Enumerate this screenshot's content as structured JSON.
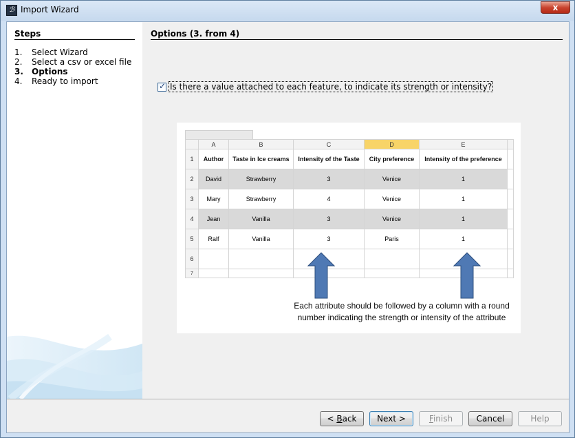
{
  "window": {
    "title": "Import Wizard",
    "close_glyph": "x",
    "app_icon_glyph": "ℬ"
  },
  "steps": {
    "title": "Steps",
    "items": [
      {
        "num": "1.",
        "label": "Select Wizard",
        "active": false
      },
      {
        "num": "2.",
        "label": "Select a csv or excel file",
        "active": false
      },
      {
        "num": "3.",
        "label": "Options",
        "active": true
      },
      {
        "num": "4.",
        "label": "Ready to import",
        "active": false
      }
    ]
  },
  "options": {
    "title": "Options (3. from 4)",
    "checkbox_label": "Is there a value attached to each feature, to indicate its strength or intensity?",
    "checkbox_checked": true
  },
  "spreadsheet": {
    "columns": [
      "A",
      "B",
      "C",
      "D",
      "E"
    ],
    "selected_column": "D",
    "rows": [
      {
        "row": "1",
        "cells": [
          "Author",
          "Taste in Ice creams",
          "Intensity of the Taste",
          "City preference",
          "Intensity of the preference"
        ]
      },
      {
        "row": "2",
        "cells": [
          "David",
          "Strawberry",
          "3",
          "Venice",
          "1"
        ]
      },
      {
        "row": "3",
        "cells": [
          "Mary",
          "Strawberry",
          "4",
          "Venice",
          "1"
        ]
      },
      {
        "row": "4",
        "cells": [
          "Jean",
          "Vanilla",
          "3",
          "Venice",
          "1"
        ]
      },
      {
        "row": "5",
        "cells": [
          "Ralf",
          "Vanilla",
          "3",
          "Paris",
          "1"
        ]
      },
      {
        "row": "6",
        "cells": [
          "",
          "",
          "",
          "",
          ""
        ]
      },
      {
        "row": "7",
        "cells": [
          "",
          "",
          "",
          "",
          ""
        ]
      }
    ],
    "caption_line1": "Each attribute should be followed by a column with a round",
    "caption_line2": "number indicating the strength or intensity of the attribute",
    "arrow_color": "#4f79b4"
  },
  "buttons": {
    "back": {
      "prefix": "< ",
      "mnemonic": "B",
      "rest": "ack"
    },
    "next": {
      "label": "Next >"
    },
    "finish": {
      "mnemonic": "F",
      "rest": "inish"
    },
    "cancel": {
      "label": "Cancel"
    },
    "help": {
      "label": "Help"
    }
  }
}
